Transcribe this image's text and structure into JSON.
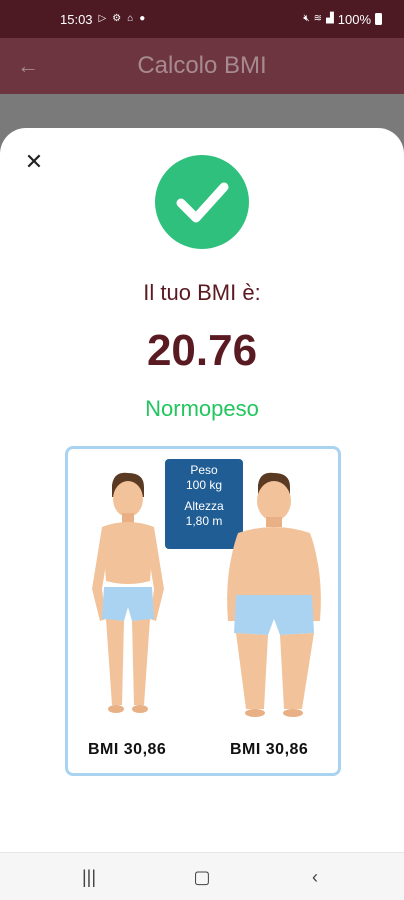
{
  "status_bar": {
    "time": "15:03",
    "battery_text": "100%",
    "left_icons": [
      "play-store-icon",
      "settings-icon",
      "vpn-icon",
      "dot-icon"
    ],
    "right_icons": [
      "mute-icon",
      "wifi-icon",
      "signal-icon",
      "battery-icon"
    ]
  },
  "app_bar": {
    "title": "Calcolo BMI",
    "back_icon": "back-arrow-icon"
  },
  "result_sheet": {
    "close_icon": "close-icon",
    "check_icon": "check-circle-icon",
    "headline": "Il tuo BMI è:",
    "bmi_value": "20.76",
    "category": "Normopeso",
    "colors": {
      "accent": "#5a1a22",
      "success": "#2ec07c",
      "category": "#22c55e"
    },
    "illustration": {
      "weight_label": "Peso",
      "weight_value": "100 kg",
      "height_label": "Altezza",
      "height_value": "1,80 m",
      "left_bmi": "BMI 30,86",
      "right_bmi": "BMI 30,86"
    }
  },
  "nav_bar": {
    "recents_icon": "recents-icon",
    "home_icon": "home-icon",
    "back_icon": "nav-back-icon"
  }
}
